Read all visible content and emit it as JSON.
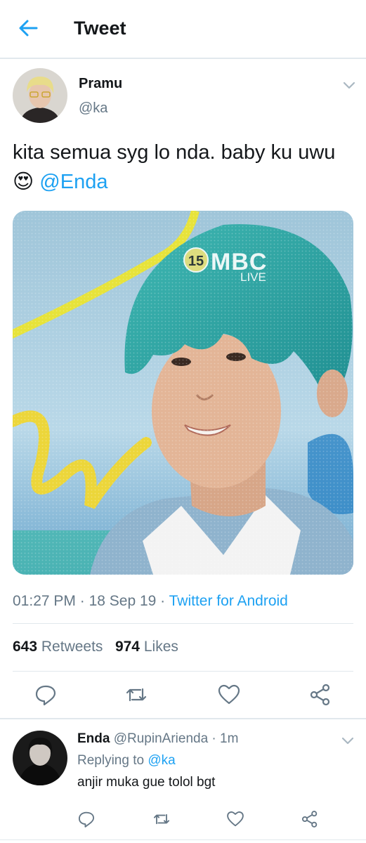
{
  "header": {
    "title": "Tweet"
  },
  "tweet": {
    "author_name": "Pramu",
    "author_handle": "@ka",
    "text": "kita semua syg lo nda. baby ku uwu",
    "emoji": "😍",
    "mention": "@Enda",
    "media_overlay": {
      "channel_number": "15",
      "logo": "MBC",
      "sub": "LIVE"
    },
    "time": "01:27 PM",
    "date": "18 Sep 19",
    "source": "Twitter for Android",
    "retweet_count": "643",
    "retweet_label": "Retweets",
    "like_count": "974",
    "like_label": "Likes"
  },
  "actions": [
    "reply-icon",
    "retweet-icon",
    "like-icon",
    "share-icon"
  ],
  "reply": {
    "name": "Enda",
    "handle": "@RupinArienda",
    "time": "1m",
    "replying_prefix": "Replying to",
    "replying_to": "@ka",
    "text": "anjir muka gue tolol bgt"
  },
  "colors": {
    "accent": "#1da1f2",
    "secondary_text": "#657786",
    "divider": "#e1e8ed"
  }
}
